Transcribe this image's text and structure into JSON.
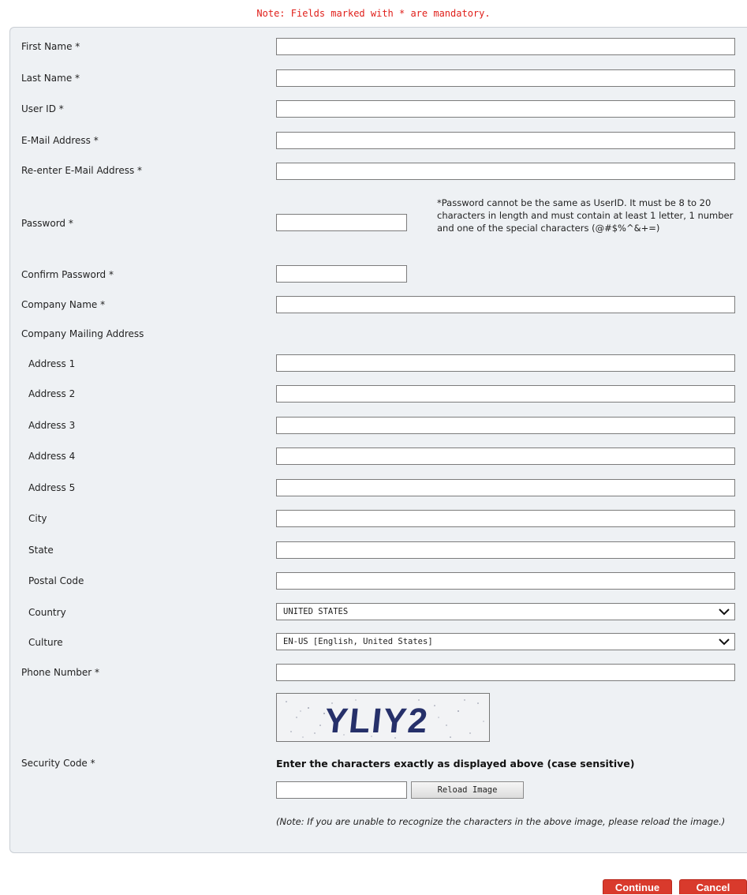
{
  "note": "Note: Fields marked with * are mandatory.",
  "fields": {
    "first_name": "First Name *",
    "last_name": "Last Name *",
    "user_id": "User ID *",
    "email": "E-Mail Address *",
    "email_confirm": "Re-enter E-Mail Address *",
    "password": "Password *",
    "confirm_password": "Confirm Password *",
    "company_name": "Company Name *",
    "mailing_address": "Company Mailing Address",
    "address1": "Address 1",
    "address2": "Address 2",
    "address3": "Address 3",
    "address4": "Address 4",
    "address5": "Address 5",
    "city": "City",
    "state": "State",
    "postal_code": "Postal Code",
    "country": "Country",
    "culture": "Culture",
    "phone": "Phone Number *",
    "security_code": "Security Code *"
  },
  "password_note": "*Password cannot be the same as UserID. It must be 8 to 20 characters in length and must contain at least 1 letter, 1 number and one of the special characters (@#$%^&+=)",
  "country_value": "UNITED STATES",
  "culture_value": "EN-US [English, United States]",
  "captcha": {
    "text": "YLIY2",
    "instruction": "Enter the characters exactly as displayed above (case sensitive)",
    "reload_label": "Reload Image",
    "note": "(Note: If you are unable to recognize the characters in the above image, please reload the image.)"
  },
  "buttons": {
    "continue": "Continue",
    "cancel": "Cancel"
  },
  "colors": {
    "note_red": "#e0201b",
    "button_red": "#d93a2c",
    "panel_bg": "#eef1f4"
  }
}
